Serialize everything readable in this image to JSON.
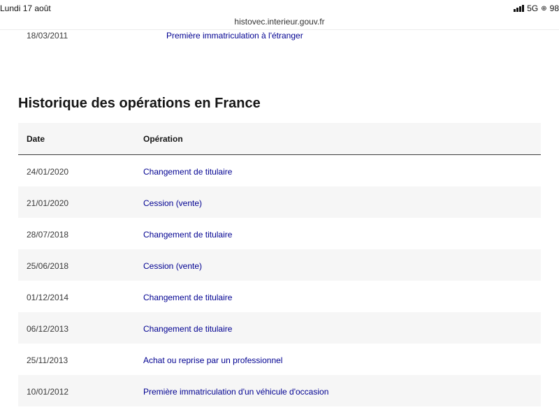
{
  "status_bar": {
    "time": "Lundi 17 août",
    "network": "5G",
    "battery": "98"
  },
  "browser": {
    "url": "histovec.interieur.gouv.fr"
  },
  "previous_row": {
    "date": "18/03/2011",
    "operation": "Première immatriculation à l'étranger"
  },
  "section": {
    "title": "Historique des opérations en France"
  },
  "table": {
    "headers": {
      "date": "Date",
      "operation": "Opération"
    },
    "rows": [
      {
        "date": "24/01/2020",
        "operation": "Changement de titulaire"
      },
      {
        "date": "21/01/2020",
        "operation": "Cession (vente)"
      },
      {
        "date": "28/07/2018",
        "operation": "Changement de titulaire"
      },
      {
        "date": "25/06/2018",
        "operation": "Cession (vente)"
      },
      {
        "date": "01/12/2014",
        "operation": "Changement de titulaire"
      },
      {
        "date": "06/12/2013",
        "operation": "Changement de titulaire"
      },
      {
        "date": "25/11/2013",
        "operation": "Achat ou reprise par un professionnel"
      },
      {
        "date": "10/01/2012",
        "operation": "Première immatriculation d'un véhicule d'occasion"
      }
    ]
  }
}
